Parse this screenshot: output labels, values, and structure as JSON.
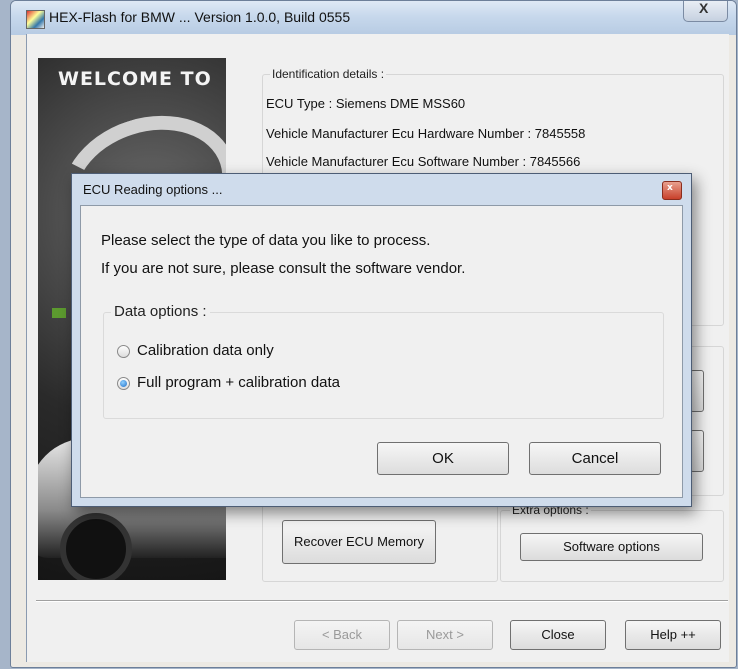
{
  "window": {
    "title": "HEX-Flash for BMW ... Version 1.0.0, Build 0555",
    "close_glyph": "X"
  },
  "banner": {
    "welcome": "WELCOME TO"
  },
  "identification": {
    "legend": "Identification details :",
    "lines": [
      "ECU Type : Siemens DME MSS60",
      "Vehicle Manufacturer Ecu Hardware Number : 7845558",
      "Vehicle Manufacturer Ecu Software Number : 7845566"
    ]
  },
  "extra_options": {
    "legend": "Extra options :",
    "software_options": "Software options"
  },
  "recover_button": "Recover ECU Memory",
  "footer": {
    "back": "< Back",
    "next": "Next >",
    "close": "Close",
    "help": "Help ++"
  },
  "dialog": {
    "title": "ECU Reading options ...",
    "close_glyph": "x",
    "line1": "Please select the type of data you like to process.",
    "line2": "If you are not sure, please consult the software vendor.",
    "data_legend": "Data options :",
    "options": [
      {
        "label": "Calibration data only",
        "selected": false
      },
      {
        "label": "Full program + calibration data",
        "selected": true
      }
    ],
    "ok": "OK",
    "cancel": "Cancel"
  }
}
